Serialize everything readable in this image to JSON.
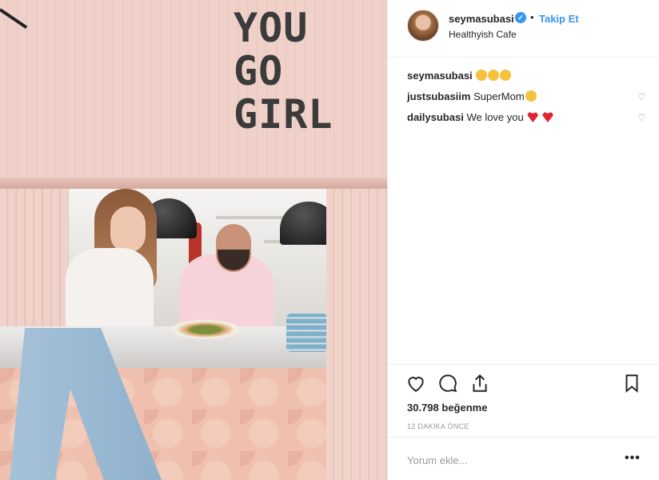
{
  "post": {
    "sign_lines": [
      "YOU",
      "GO",
      "GIRL"
    ],
    "image_alt": "Photo"
  },
  "header": {
    "username": "seymasubasi",
    "verified_mark": "✓",
    "separator": "•",
    "follow_label": "Takip Et",
    "location": "Healthyish Cafe"
  },
  "comments": [
    {
      "user": "seymasubasi",
      "text": "",
      "emojis": [
        "yellow",
        "yellow",
        "yellow"
      ],
      "has_like": false
    },
    {
      "user": "justsubasiim",
      "text": "SuperMom",
      "emojis": [
        "yellow"
      ],
      "has_like": true
    },
    {
      "user": "dailysubasi",
      "text": "We love you",
      "emojis": [
        "red",
        "red"
      ],
      "has_like": true
    }
  ],
  "actions": {
    "like_icon": "heart-icon",
    "comment_icon": "comment-icon",
    "share_icon": "share-icon",
    "save_icon": "bookmark-icon"
  },
  "likes_text": "30.798 beğenme",
  "timestamp": "12 DAKİKA ÖNCE",
  "comment_input": {
    "placeholder": "Yorum ekle..."
  },
  "more_label": "•••",
  "colors": {
    "accent": "#3897f0",
    "text": "#262626",
    "muted": "#999999",
    "wall": "#f0d1c9"
  }
}
